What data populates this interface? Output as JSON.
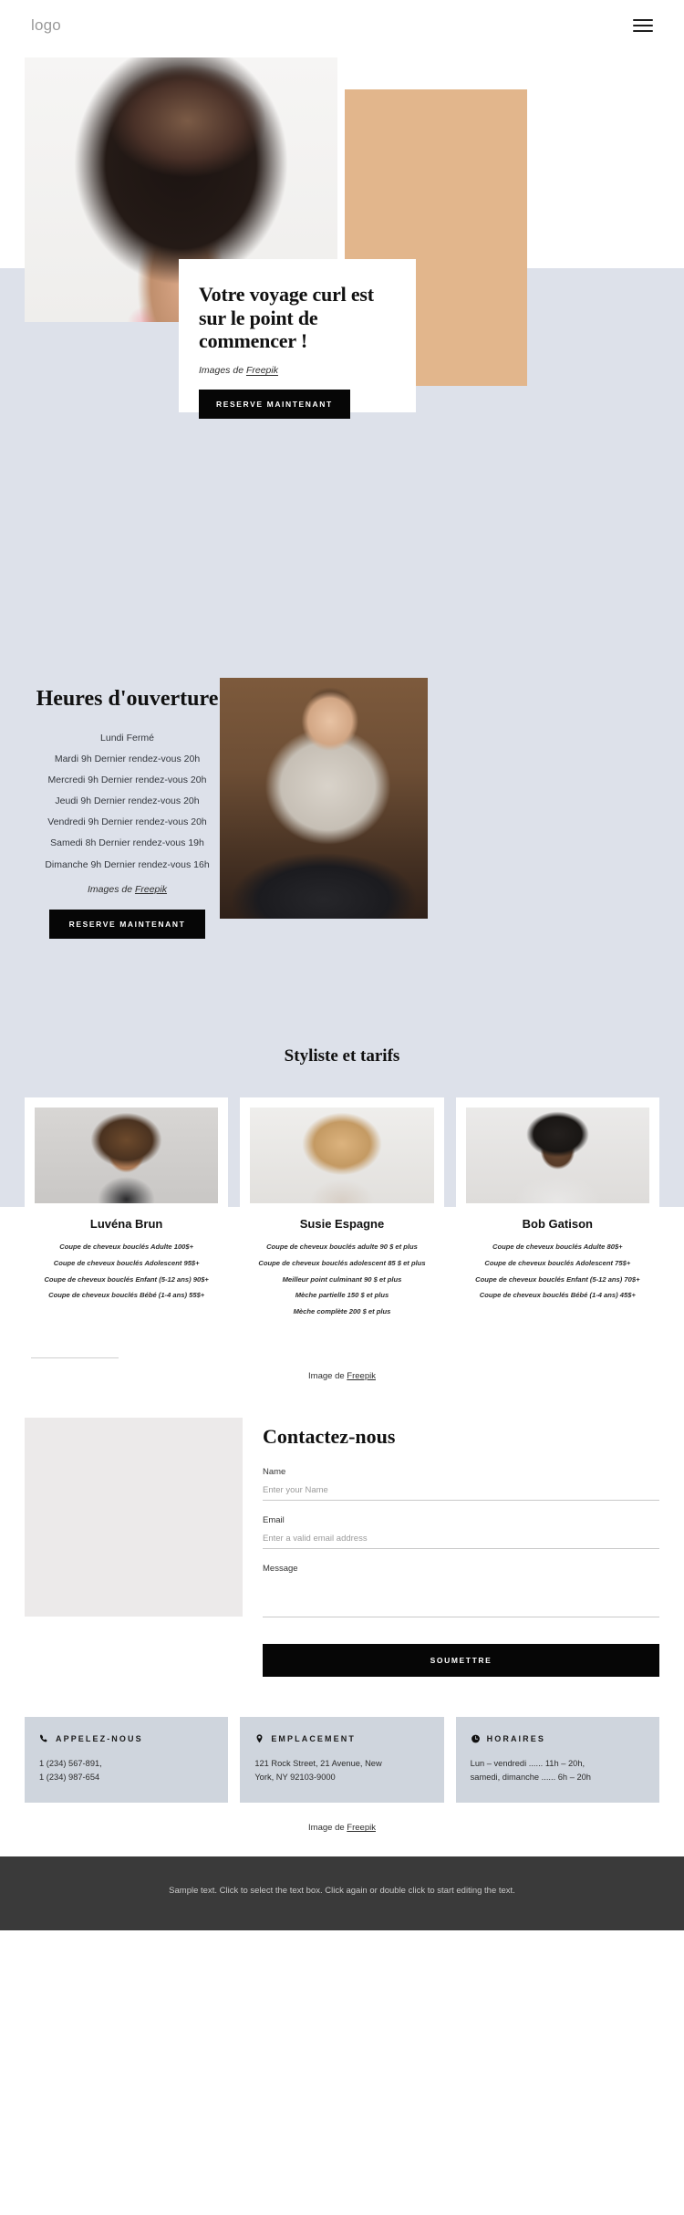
{
  "header": {
    "logo": "logo",
    "menu_icon": "hamburger-icon"
  },
  "hero": {
    "title": "Votre voyage curl est sur le point de commencer !",
    "credit_prefix": "Images de ",
    "credit_link": "Freepik",
    "cta": "RESERVE MAINTENANT"
  },
  "hours": {
    "title": "Heures d'ouverture",
    "lines": [
      "Lundi Fermé",
      "Mardi 9h Dernier rendez-vous 20h",
      "Mercredi 9h Dernier rendez-vous 20h",
      "Jeudi 9h Dernier rendez-vous 20h",
      "Vendredi 9h Dernier rendez-vous 20h",
      "Samedi 8h Dernier rendez-vous 19h",
      "Dimanche 9h Dernier rendez-vous 16h"
    ],
    "credit_prefix": "Images de ",
    "credit_link": "Freepik",
    "cta": "RESERVE MAINTENANT"
  },
  "stylists": {
    "title": "Styliste et tarifs",
    "credit_prefix": "Image de ",
    "credit_link": "Freepik",
    "cards": [
      {
        "name": "Luvéna Brun",
        "prices": [
          "Coupe de cheveux bouclés Adulte 100$+",
          "Coupe de cheveux bouclés Adolescent 95$+",
          "Coupe de cheveux bouclés Enfant (5-12 ans) 90$+",
          "Coupe de cheveux bouclés Bébé (1-4 ans) 55$+"
        ]
      },
      {
        "name": "Susie Espagne",
        "prices": [
          "Coupe de cheveux bouclés adulte 90 $ et plus",
          "Coupe de cheveux bouclés adolescent 85 $ et plus",
          "Meilleur point culminant 90 $ et plus",
          "Mèche partielle 150 $ et plus",
          "Mèche complète 200 $ et plus"
        ]
      },
      {
        "name": "Bob Gatison",
        "prices": [
          "Coupe de cheveux bouclés Adulte 80$+",
          "Coupe de cheveux bouclés Adolescent 75$+",
          "Coupe de cheveux bouclés Enfant (5-12 ans) 70$+",
          "Coupe de cheveux bouclés Bébé (1-4 ans) 45$+"
        ]
      }
    ]
  },
  "contact": {
    "title": "Contactez-nous",
    "name_label": "Name",
    "name_placeholder": "Enter your Name",
    "email_label": "Email",
    "email_placeholder": "Enter a valid email address",
    "message_label": "Message",
    "message_placeholder": "",
    "submit": "SOUMETTRE"
  },
  "info": [
    {
      "icon": "phone-icon",
      "title": "APPELEZ-NOUS",
      "lines": [
        "1 (234) 567-891,",
        "1 (234) 987-654"
      ]
    },
    {
      "icon": "location-pin-icon",
      "title": "EMPLACEMENT",
      "lines": [
        "121 Rock Street, 21 Avenue, New",
        "York, NY 92103-9000"
      ]
    },
    {
      "icon": "clock-icon",
      "title": "HORAIRES",
      "lines": [
        "Lun – vendredi ...... 11h – 20h,",
        "samedi, dimanche  ...... 6h – 20h"
      ]
    }
  ],
  "footer_credit": {
    "prefix": "Image de ",
    "link": "Freepik"
  },
  "footer": {
    "text": "Sample text. Click to select the text box. Click again or double click to start editing the text."
  },
  "colors": {
    "band": "#dde1ea",
    "tan": "#e2b68c",
    "dark": "#060606",
    "info_box": "#cfd5dd",
    "footer_bg": "#3a3a3a"
  }
}
